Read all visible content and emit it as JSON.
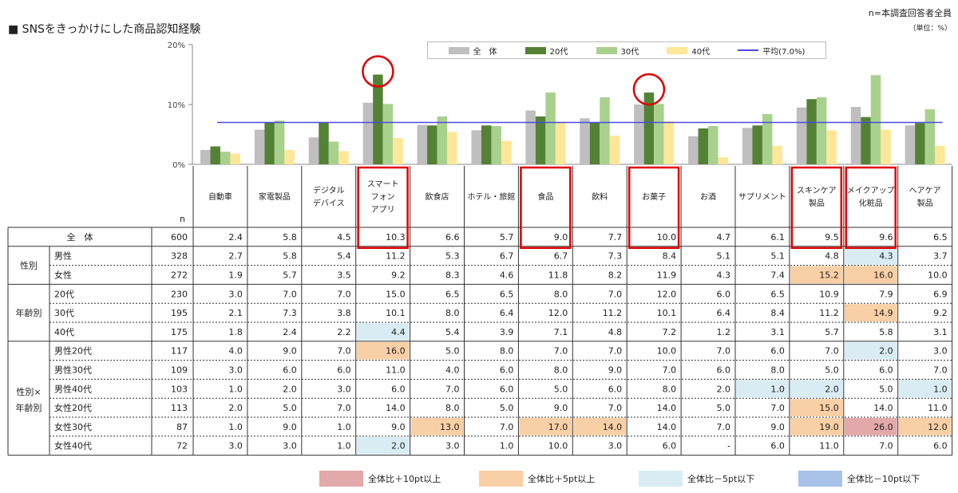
{
  "page": {
    "title": "■ SNSをきっかけにした商品認知経験",
    "note_n": "n=本調査回答者全員",
    "note_unit": "（単位：%）"
  },
  "legend_bottom": [
    {
      "label": "全体比＋10pt以上",
      "color": "#e3a9aa"
    },
    {
      "label": "全体比＋5pt以上",
      "color": "#f9cfa5"
    },
    {
      "label": "全体比－5pt以下",
      "color": "#d9ecf4"
    },
    {
      "label": "全体比－10pt以下",
      "color": "#a8c2ea"
    }
  ],
  "table": {
    "n_header": "n",
    "group_labels": {
      "gender": "性別",
      "age": "年齢別",
      "gender_age_1": "性別×",
      "gender_age_2": "年齢別"
    }
  },
  "highlight_colors": {
    "orange": "#f9cfa5",
    "lightblue": "#d9ecf4",
    "pink": "#e3a9aa",
    "red": "#e00000"
  },
  "chart_data": {
    "type": "bar",
    "categories": [
      [
        "自動車"
      ],
      [
        "家電製品"
      ],
      [
        "デジタル",
        "デバイス"
      ],
      [
        "スマート",
        "フォン",
        "アプリ"
      ],
      [
        "飲食店"
      ],
      [
        "ホテル・旅館"
      ],
      [
        "食品"
      ],
      [
        "飲料"
      ],
      [
        "お菓子"
      ],
      [
        "お酒"
      ],
      [
        "サプリメント"
      ],
      [
        "スキンケア",
        "製品"
      ],
      [
        "メイクアップ",
        "化粧品"
      ],
      [
        "ヘアケア",
        "製品"
      ]
    ],
    "series": [
      {
        "name": "全　体",
        "color": "#bfbfbf",
        "values": [
          2.4,
          5.8,
          4.5,
          10.3,
          6.6,
          5.7,
          9.0,
          7.7,
          10.0,
          4.7,
          6.1,
          9.5,
          9.6,
          6.5
        ]
      },
      {
        "name": "20代",
        "color": "#548235",
        "values": [
          3.0,
          7.0,
          7.0,
          15.0,
          6.5,
          6.5,
          8.0,
          7.0,
          12.0,
          6.0,
          6.5,
          10.9,
          7.9,
          6.9
        ]
      },
      {
        "name": "30代",
        "color": "#a9d18e",
        "values": [
          2.1,
          7.3,
          3.8,
          10.1,
          8.0,
          6.4,
          12.0,
          11.2,
          10.1,
          6.4,
          8.4,
          11.2,
          14.9,
          9.2
        ]
      },
      {
        "name": "40代",
        "color": "#ffe699",
        "values": [
          1.8,
          2.4,
          2.2,
          4.4,
          5.4,
          3.9,
          7.1,
          4.8,
          7.2,
          1.2,
          3.1,
          5.7,
          5.8,
          3.1
        ]
      }
    ],
    "average": {
      "name": "平均(7.0%)",
      "value": 7.0,
      "color": "#4a4ae0"
    },
    "yticks": [
      "0%",
      "10%",
      "20%"
    ],
    "ylim": [
      0,
      20
    ],
    "circled_categories": [
      3,
      8
    ],
    "boxed_categories": [
      3,
      6,
      8,
      11,
      12
    ],
    "rows": [
      {
        "label": "全　体",
        "n": "600",
        "values": [
          "2.4",
          "5.8",
          "4.5",
          "10.3",
          "6.6",
          "5.7",
          "9.0",
          "7.7",
          "10.0",
          "4.7",
          "6.1",
          "9.5",
          "9.6",
          "6.5"
        ],
        "hl": []
      },
      {
        "label": "男性",
        "n": "328",
        "values": [
          "2.7",
          "5.8",
          "5.4",
          "11.2",
          "5.3",
          "6.7",
          "6.7",
          "7.3",
          "8.4",
          "5.1",
          "5.1",
          "4.8",
          "4.3",
          "3.7"
        ],
        "hl": [
          [
            12,
            "lightblue"
          ]
        ]
      },
      {
        "label": "女性",
        "n": "272",
        "values": [
          "1.9",
          "5.7",
          "3.5",
          "9.2",
          "8.3",
          "4.6",
          "11.8",
          "8.2",
          "11.9",
          "4.3",
          "7.4",
          "15.2",
          "16.0",
          "10.0"
        ],
        "hl": [
          [
            11,
            "orange"
          ],
          [
            12,
            "orange"
          ]
        ]
      },
      {
        "label": "20代",
        "n": "230",
        "values": [
          "3.0",
          "7.0",
          "7.0",
          "15.0",
          "6.5",
          "6.5",
          "8.0",
          "7.0",
          "12.0",
          "6.0",
          "6.5",
          "10.9",
          "7.9",
          "6.9"
        ],
        "hl": []
      },
      {
        "label": "30代",
        "n": "195",
        "values": [
          "2.1",
          "7.3",
          "3.8",
          "10.1",
          "8.0",
          "6.4",
          "12.0",
          "11.2",
          "10.1",
          "6.4",
          "8.4",
          "11.2",
          "14.9",
          "9.2"
        ],
        "hl": [
          [
            12,
            "orange"
          ]
        ]
      },
      {
        "label": "40代",
        "n": "175",
        "values": [
          "1.8",
          "2.4",
          "2.2",
          "4.4",
          "5.4",
          "3.9",
          "7.1",
          "4.8",
          "7.2",
          "1.2",
          "3.1",
          "5.7",
          "5.8",
          "3.1"
        ],
        "hl": [
          [
            3,
            "lightblue"
          ]
        ]
      },
      {
        "label": "男性20代",
        "n": "117",
        "values": [
          "4.0",
          "9.0",
          "7.0",
          "16.0",
          "5.0",
          "8.0",
          "7.0",
          "7.0",
          "10.0",
          "7.0",
          "6.0",
          "7.0",
          "2.0",
          "3.0"
        ],
        "hl": [
          [
            3,
            "orange"
          ],
          [
            12,
            "lightblue"
          ]
        ]
      },
      {
        "label": "男性30代",
        "n": "109",
        "values": [
          "3.0",
          "6.0",
          "6.0",
          "11.0",
          "4.0",
          "6.0",
          "8.0",
          "9.0",
          "7.0",
          "6.0",
          "8.0",
          "5.0",
          "6.0",
          "7.0"
        ],
        "hl": []
      },
      {
        "label": "男性40代",
        "n": "103",
        "values": [
          "1.0",
          "2.0",
          "3.0",
          "6.0",
          "7.0",
          "6.0",
          "5.0",
          "6.0",
          "8.0",
          "2.0",
          "1.0",
          "2.0",
          "5.0",
          "1.0"
        ],
        "hl": [
          [
            10,
            "lightblue"
          ],
          [
            11,
            "lightblue"
          ],
          [
            13,
            "lightblue"
          ]
        ]
      },
      {
        "label": "女性20代",
        "n": "113",
        "values": [
          "2.0",
          "5.0",
          "7.0",
          "14.0",
          "8.0",
          "5.0",
          "9.0",
          "7.0",
          "14.0",
          "5.0",
          "7.0",
          "15.0",
          "14.0",
          "11.0"
        ],
        "hl": [
          [
            11,
            "orange"
          ]
        ]
      },
      {
        "label": "女性30代",
        "n": "87",
        "values": [
          "1.0",
          "9.0",
          "1.0",
          "9.0",
          "13.0",
          "7.0",
          "17.0",
          "14.0",
          "14.0",
          "7.0",
          "9.0",
          "19.0",
          "26.0",
          "12.0"
        ],
        "hl": [
          [
            4,
            "orange"
          ],
          [
            6,
            "orange"
          ],
          [
            7,
            "orange"
          ],
          [
            11,
            "orange"
          ],
          [
            12,
            "pink"
          ],
          [
            13,
            "orange"
          ]
        ]
      },
      {
        "label": "女性40代",
        "n": "72",
        "values": [
          "3.0",
          "3.0",
          "1.0",
          "2.0",
          "3.0",
          "1.0",
          "10.0",
          "3.0",
          "6.0",
          "-",
          "6.0",
          "11.0",
          "7.0",
          "6.0"
        ],
        "hl": [
          [
            3,
            "lightblue"
          ]
        ]
      }
    ]
  }
}
